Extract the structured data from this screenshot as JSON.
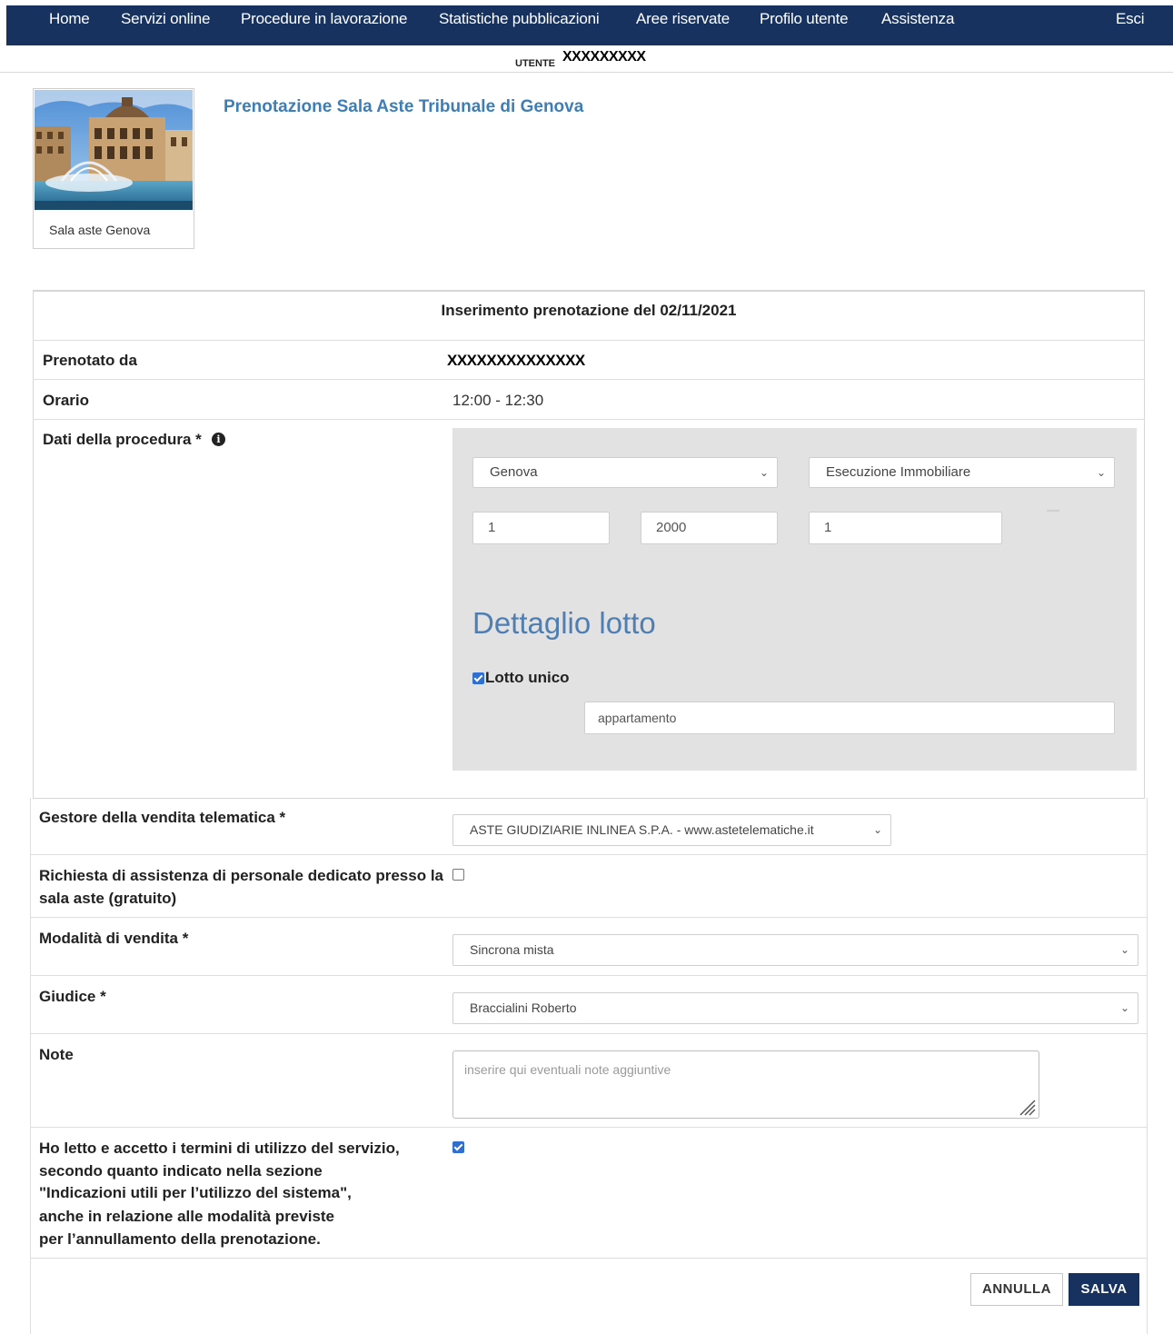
{
  "nav": {
    "items": [
      "Home",
      "Servizi online",
      "Procedure in lavorazione",
      "Statistiche pubblicazioni",
      "Aree riservate",
      "Profilo utente",
      "Assistenza"
    ],
    "logout": "Esci"
  },
  "user": {
    "label": "UTENTE",
    "value": "XXXXXXXXX"
  },
  "thumbnail": {
    "caption": "Sala aste Genova"
  },
  "page_title": "Prenotazione Sala Aste Tribunale di Genova",
  "form": {
    "heading": "Inserimento prenotazione del 02/11/2021",
    "booked_by_label": "Prenotato da",
    "booked_by_value": "XXXXXXXXXXXXXX",
    "time_label": "Orario",
    "time_value": "12:00 - 12:30",
    "procedure_label": "Dati della procedura *",
    "procedure": {
      "court": "Genova",
      "type": "Esecuzione Immobiliare",
      "field1": "1",
      "field2": "2000",
      "field3": "1"
    },
    "lot_title": "Dettaglio lotto",
    "single_lot_label": "Lotto unico",
    "single_lot_checked": true,
    "lot_description": "appartamento",
    "manager_label": "Gestore della vendita telematica *",
    "manager_value": "ASTE GIUDIZIARIE INLINEA S.P.A. - www.astetelematiche.it",
    "assist_label_1": "Richiesta di assistenza di personale dedicato presso la",
    "assist_label_2": "sala aste (gratuito)",
    "assist_checked": false,
    "sale_mode_label": "Modalità di vendita *",
    "sale_mode_value": "Sincrona mista",
    "judge_label": "Giudice *",
    "judge_value": "Braccialini Roberto",
    "notes_label": "Note",
    "notes_placeholder": "inserire qui eventuali note aggiuntive",
    "terms_lines": [
      "Ho letto e accetto i termini di utilizzo del servizio,",
      "secondo quanto indicato nella sezione",
      "\"Indicazioni utili per l’utilizzo del sistema\",",
      "anche in relazione alle modalità previste",
      "per l’annullamento della prenotazione."
    ],
    "terms_checked": true
  },
  "buttons": {
    "cancel": "ANNULLA",
    "save": "SALVA"
  },
  "colors": {
    "nav_bg": "#17325f",
    "title": "#3d7eb5",
    "accent": "#2f6fd1"
  }
}
